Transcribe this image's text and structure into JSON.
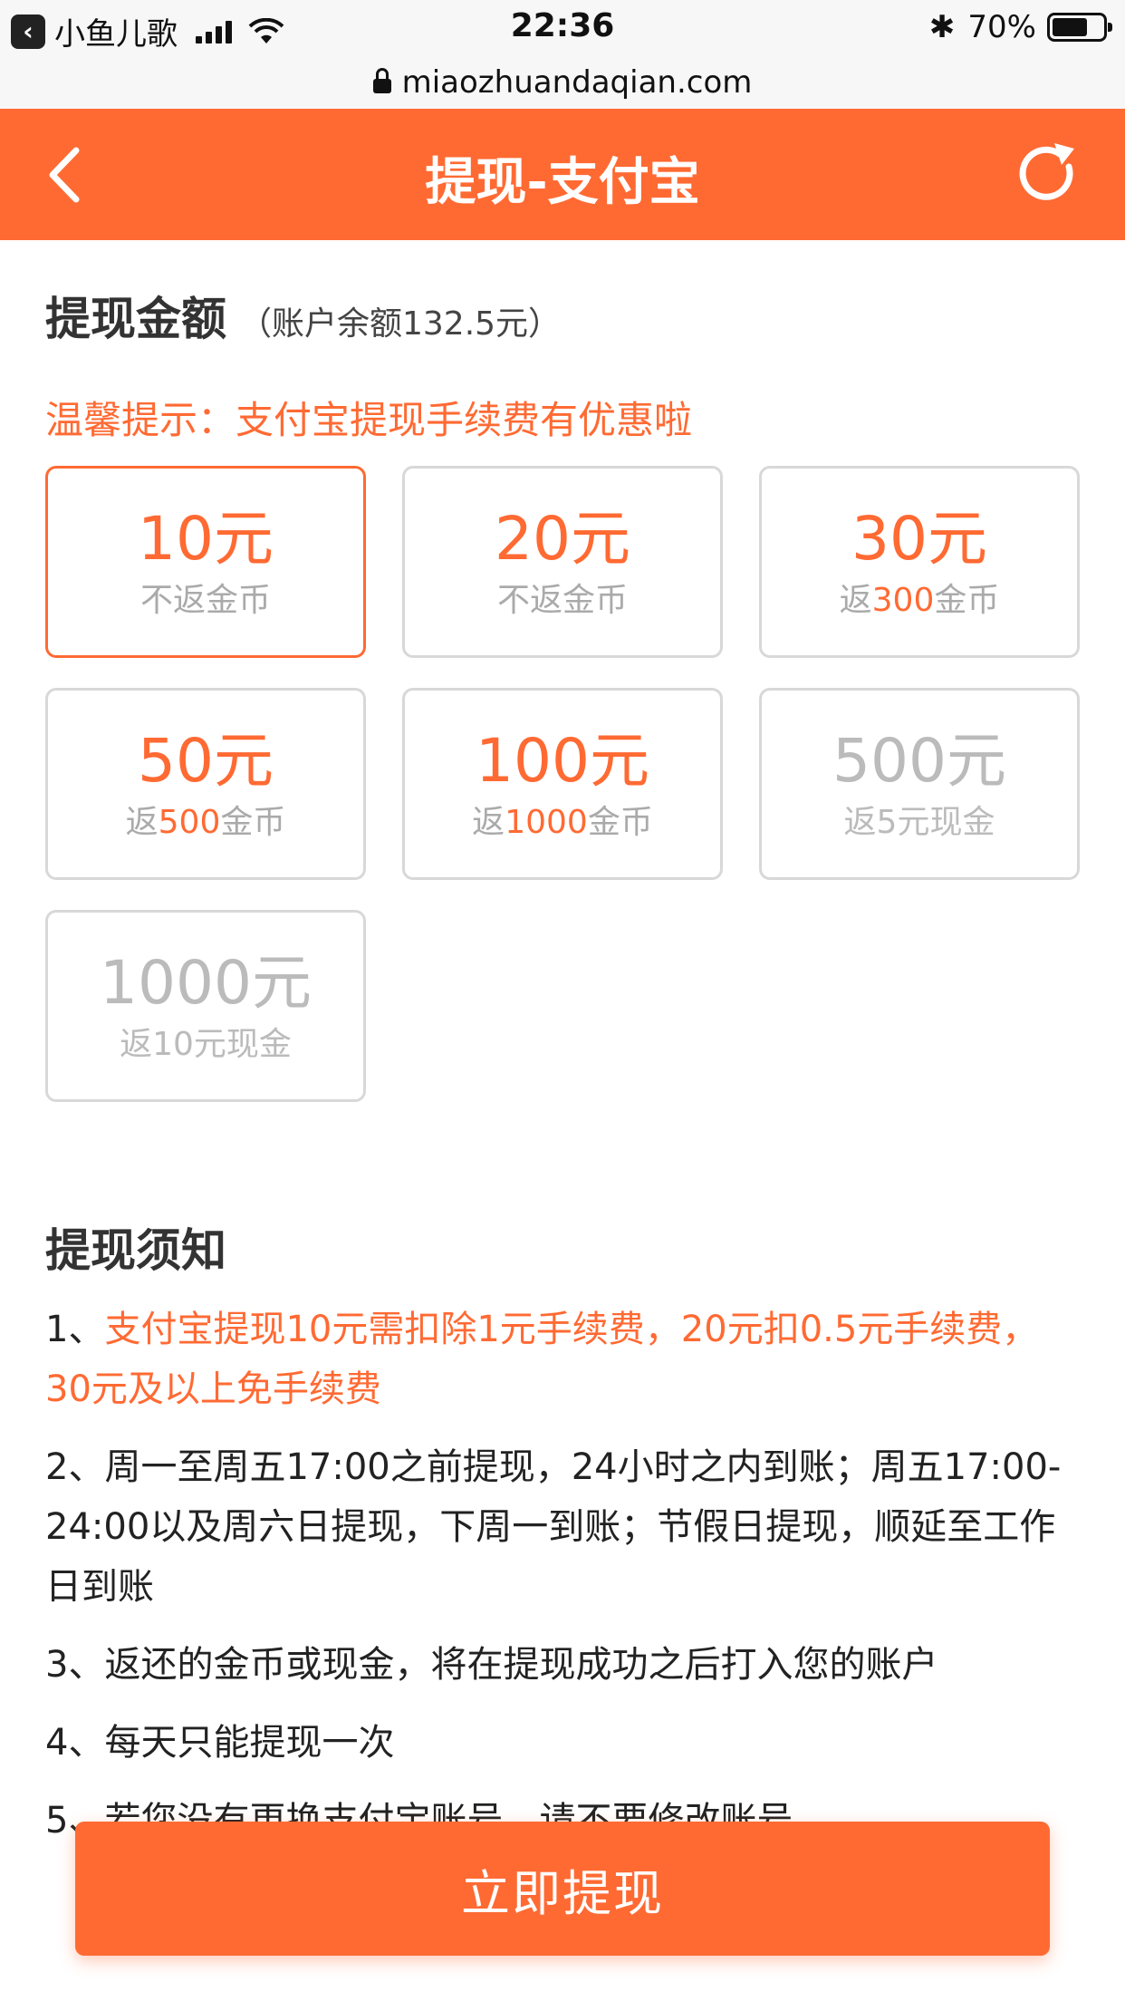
{
  "status_bar": {
    "back_app_name": "小鱼儿歌",
    "time": "22:36",
    "battery_percent": "70%",
    "battery_level": 0.7
  },
  "url_bar": {
    "url": "miaozhuandaqian.com"
  },
  "header": {
    "title": "提现-支付宝"
  },
  "amount_section": {
    "title": "提现金额",
    "balance": "（账户余额132.5元）",
    "tip": "温馨提示：支付宝提现手续费有优惠啦"
  },
  "options": [
    {
      "amount": "10元",
      "pre": "不返金币",
      "hl": "",
      "post": "",
      "selected": true,
      "disabled": false
    },
    {
      "amount": "20元",
      "pre": "不返金币",
      "hl": "",
      "post": "",
      "selected": false,
      "disabled": false
    },
    {
      "amount": "30元",
      "pre": "返",
      "hl": "300",
      "post": "金币",
      "selected": false,
      "disabled": false
    },
    {
      "amount": "50元",
      "pre": "返",
      "hl": "500",
      "post": "金币",
      "selected": false,
      "disabled": false
    },
    {
      "amount": "100元",
      "pre": "返",
      "hl": "1000",
      "post": "金币",
      "selected": false,
      "disabled": false
    },
    {
      "amount": "500元",
      "pre": "返5元现金",
      "hl": "",
      "post": "",
      "selected": false,
      "disabled": true
    },
    {
      "amount": "1000元",
      "pre": "返10元现金",
      "hl": "",
      "post": "",
      "selected": false,
      "disabled": true
    }
  ],
  "notice": {
    "title": "提现须知",
    "items": [
      {
        "num": "1、",
        "text": "支付宝提现10元需扣除1元手续费，20元扣0.5元手续费，30元及以上免手续费",
        "orange": true
      },
      {
        "num": "2、",
        "text": "周一至周五17:00之前提现，24小时之内到账；周五17:00-24:00以及周六日提现，下周一到账；节假日提现，顺延至工作日到账",
        "orange": false
      },
      {
        "num": "3、",
        "text": "返还的金币或现金，将在提现成功之后打入您的账户",
        "orange": false
      },
      {
        "num": "4、",
        "text": "每天只能提现一次",
        "orange": false
      },
      {
        "num": "5、",
        "text": "若您没有更换支付宝账号，请不要修改账号",
        "orange": false
      }
    ]
  },
  "submit_button": {
    "label": "立即提现"
  },
  "colors": {
    "accent": "#ff6a33",
    "border": "#d8d8d8",
    "disabled": "#bbbbbb"
  }
}
